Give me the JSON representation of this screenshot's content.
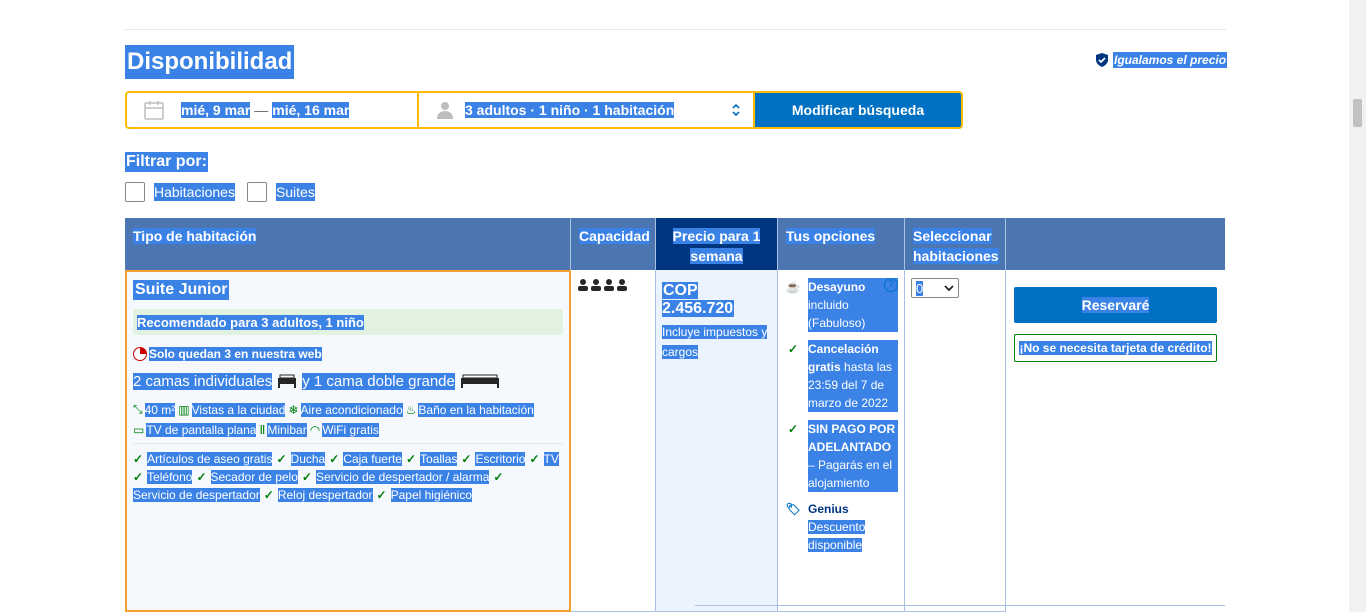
{
  "page": {
    "title": "Disponibilidad",
    "price_match": "Igualamos el precio"
  },
  "search": {
    "checkin": "mié, 9 mar",
    "separator": "—",
    "checkout": "mié, 16 mar",
    "guests": "3 adultos · 1 niño · 1 habitación",
    "button": "Modificar búsqueda"
  },
  "filters": {
    "title": "Filtrar por:",
    "items": [
      "Habitaciones",
      "Suites"
    ]
  },
  "table": {
    "headers": [
      "Tipo de habitación",
      "Capacidad",
      "Precio para 1 semana",
      "Tus opciones",
      "Seleccionar habitaciones"
    ]
  },
  "room": {
    "name": "Suite Junior",
    "recommended": "Recomendado para 3 adultos, 1 niño",
    "scarcity": "Solo quedan 3 en nuestra web",
    "beds_part1": "2 camas individuales",
    "beds_part2": "y 1 cama doble grande",
    "features": [
      "40 m²",
      "Vistas a la ciudad",
      "Aire acondicionado",
      "Baño en la habitación",
      "TV de pantalla plana",
      "Minibar",
      "WiFi gratis"
    ],
    "amenities": [
      "Artículos de aseo gratis",
      "Ducha",
      "Caja fuerte",
      "Toallas",
      "Escritorio",
      "TV",
      "Teléfono",
      "Secador de pelo",
      "Servicio de despertador / alarma",
      "Servicio de despertador",
      "Reloj despertador",
      "Papel higiénico"
    ],
    "capacity_icons": "4-person-icons",
    "price": "COP 2.456.720",
    "price_note": "Incluye impuestos y cargos",
    "options": {
      "breakfast_bold": "Desayuno",
      "breakfast_text": "incluido (Fabuloso)",
      "cancel_bold": "Cancelación gratis",
      "cancel_text": "hasta las 23:59 del 7 de marzo de 2022",
      "nopay_bold": "SIN PAGO POR ADELANTADO",
      "nopay_text": "– Pagarás en el alojamiento",
      "genius_bold": "Genius",
      "genius_text": "Descuento disponible"
    },
    "select_value": "0",
    "reserve_button": "Reservaré",
    "no_card": "¡No se necesita tarjeta de crédito!"
  },
  "colors": {
    "accent": "#0071c2",
    "header": "#4b76b2",
    "dark": "#003580",
    "highlight": "#febb02",
    "green": "#008009"
  }
}
